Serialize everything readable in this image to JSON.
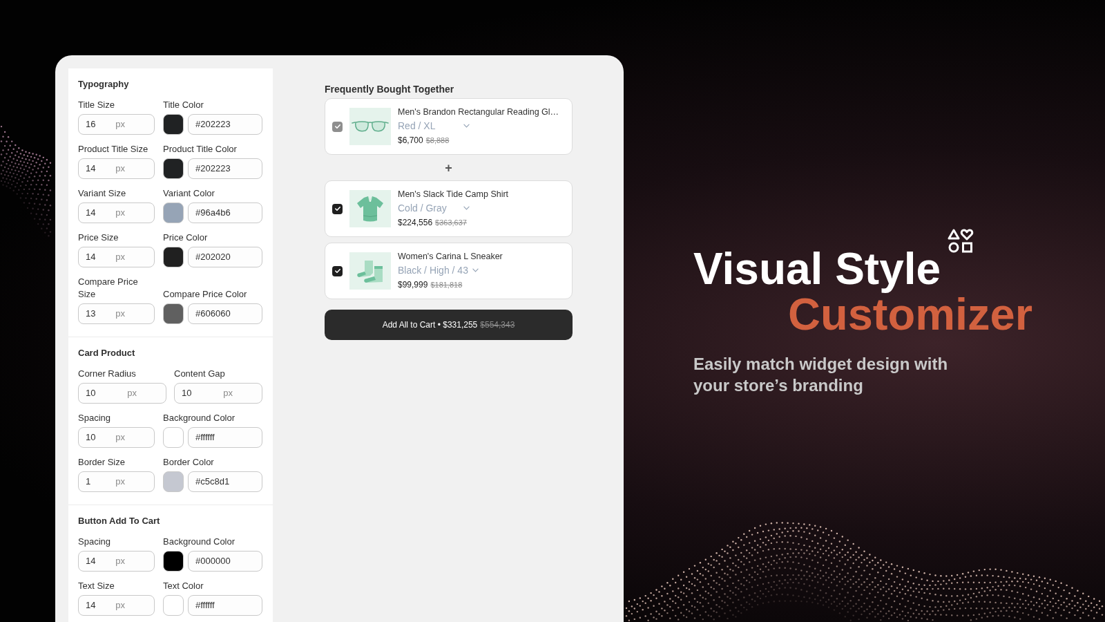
{
  "settings": {
    "sections": [
      {
        "title": "Typography",
        "rows": [
          {
            "fields": [
              {
                "kind": "size",
                "label": "Title Size",
                "value": "16",
                "unit": "px"
              },
              {
                "kind": "color",
                "label": "Title Color",
                "value": "#202223",
                "color": "#202223"
              }
            ]
          },
          {
            "fields": [
              {
                "kind": "size",
                "label": "Product Title Size",
                "value": "14",
                "unit": "px"
              },
              {
                "kind": "color",
                "label": "Product Title Color",
                "value": "#202223",
                "color": "#202223"
              }
            ]
          },
          {
            "fields": [
              {
                "kind": "size",
                "label": "Variant Size",
                "value": "14",
                "unit": "px"
              },
              {
                "kind": "color",
                "label": "Variant Color",
                "value": "#96a4b6",
                "color": "#96a4b6"
              }
            ]
          },
          {
            "fields": [
              {
                "kind": "size",
                "label": "Price Size",
                "value": "14",
                "unit": "px"
              },
              {
                "kind": "color",
                "label": "Price Color",
                "value": "#202020",
                "color": "#202020"
              }
            ]
          },
          {
            "fields": [
              {
                "kind": "size",
                "label": "Compare Price Size",
                "value": "13",
                "unit": "px"
              },
              {
                "kind": "color",
                "label": "Compare Price Color",
                "value": "#606060",
                "color": "#606060"
              }
            ]
          }
        ]
      },
      {
        "title": "Card Product",
        "rows": [
          {
            "fields": [
              {
                "kind": "size",
                "label": "Corner Radius",
                "value": "10",
                "unit": "px"
              },
              {
                "kind": "size",
                "label": "Content Gap",
                "value": "10",
                "unit": "px"
              }
            ]
          },
          {
            "fields": [
              {
                "kind": "size",
                "label": "Spacing",
                "value": "10",
                "unit": "px"
              },
              {
                "kind": "color",
                "label": "Background Color",
                "value": "#ffffff",
                "color": "#ffffff"
              }
            ]
          },
          {
            "fields": [
              {
                "kind": "size",
                "label": "Border Size",
                "value": "1",
                "unit": "px"
              },
              {
                "kind": "color",
                "label": "Border Color",
                "value": "#c5c8d1",
                "color": "#c5c8d1"
              }
            ]
          }
        ]
      },
      {
        "title": "Button Add To Cart",
        "rows": [
          {
            "fields": [
              {
                "kind": "size",
                "label": "Spacing",
                "value": "14",
                "unit": "px"
              },
              {
                "kind": "color",
                "label": "Background Color",
                "value": "#000000",
                "color": "#000000"
              }
            ]
          },
          {
            "fields": [
              {
                "kind": "size",
                "label": "Text Size",
                "value": "14",
                "unit": "px"
              },
              {
                "kind": "color",
                "label": "Text Color",
                "value": "#ffffff",
                "color": "#ffffff"
              }
            ]
          }
        ]
      }
    ]
  },
  "preview": {
    "title": "Frequently Bought Together",
    "products": [
      {
        "kind": "glasses",
        "checked": true,
        "disabled": true,
        "title": "Men's Brandon Rectangular Reading Gl…",
        "variant": "Red / XL",
        "price": "$6,700",
        "compare_price": "$8,888"
      },
      {
        "kind": "shirt",
        "checked": true,
        "disabled": false,
        "title": "Men's Slack Tide Camp Shirt",
        "variant": "Cold / Gray",
        "price": "$224,556",
        "compare_price": "$363,637"
      },
      {
        "kind": "shoes",
        "checked": true,
        "disabled": false,
        "title": "Women's Carina L Sneaker",
        "variant": "Black / High / 43",
        "price": "$99,999",
        "compare_price": "$181,818"
      }
    ],
    "separator": "+",
    "button": {
      "label": "Add All to Cart • $331,255",
      "compare_price": "$554,343"
    }
  },
  "hero": {
    "title": "Visual Style",
    "title_accent": "Customizer",
    "subtitle": "Easily match widget design with your store’s branding"
  }
}
